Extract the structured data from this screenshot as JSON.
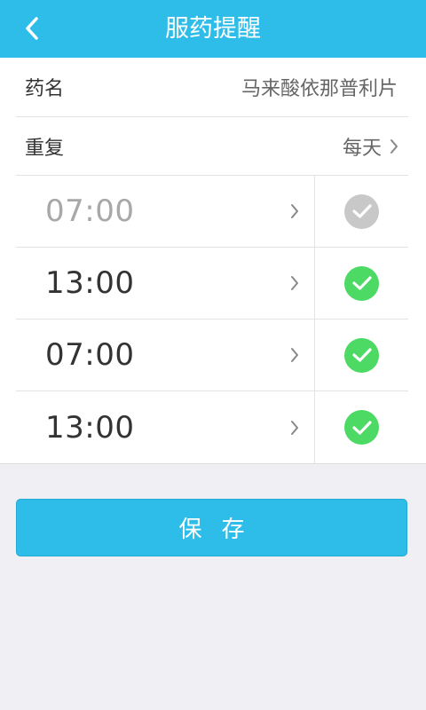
{
  "header": {
    "title": "服药提醒",
    "back_icon": "chevron-left-icon"
  },
  "drug": {
    "label": "药名",
    "value": "马来酸依那普利片"
  },
  "repeat": {
    "label": "重复",
    "value": "每天"
  },
  "times": [
    {
      "time": "07:00",
      "enabled": false
    },
    {
      "time": "13:00",
      "enabled": true
    },
    {
      "time": "07:00",
      "enabled": true
    },
    {
      "time": "13:00",
      "enabled": true
    }
  ],
  "save_label": "保存",
  "colors": {
    "accent": "#2ebde8",
    "check_on": "#4cd964",
    "check_off": "#c8c8c8"
  }
}
